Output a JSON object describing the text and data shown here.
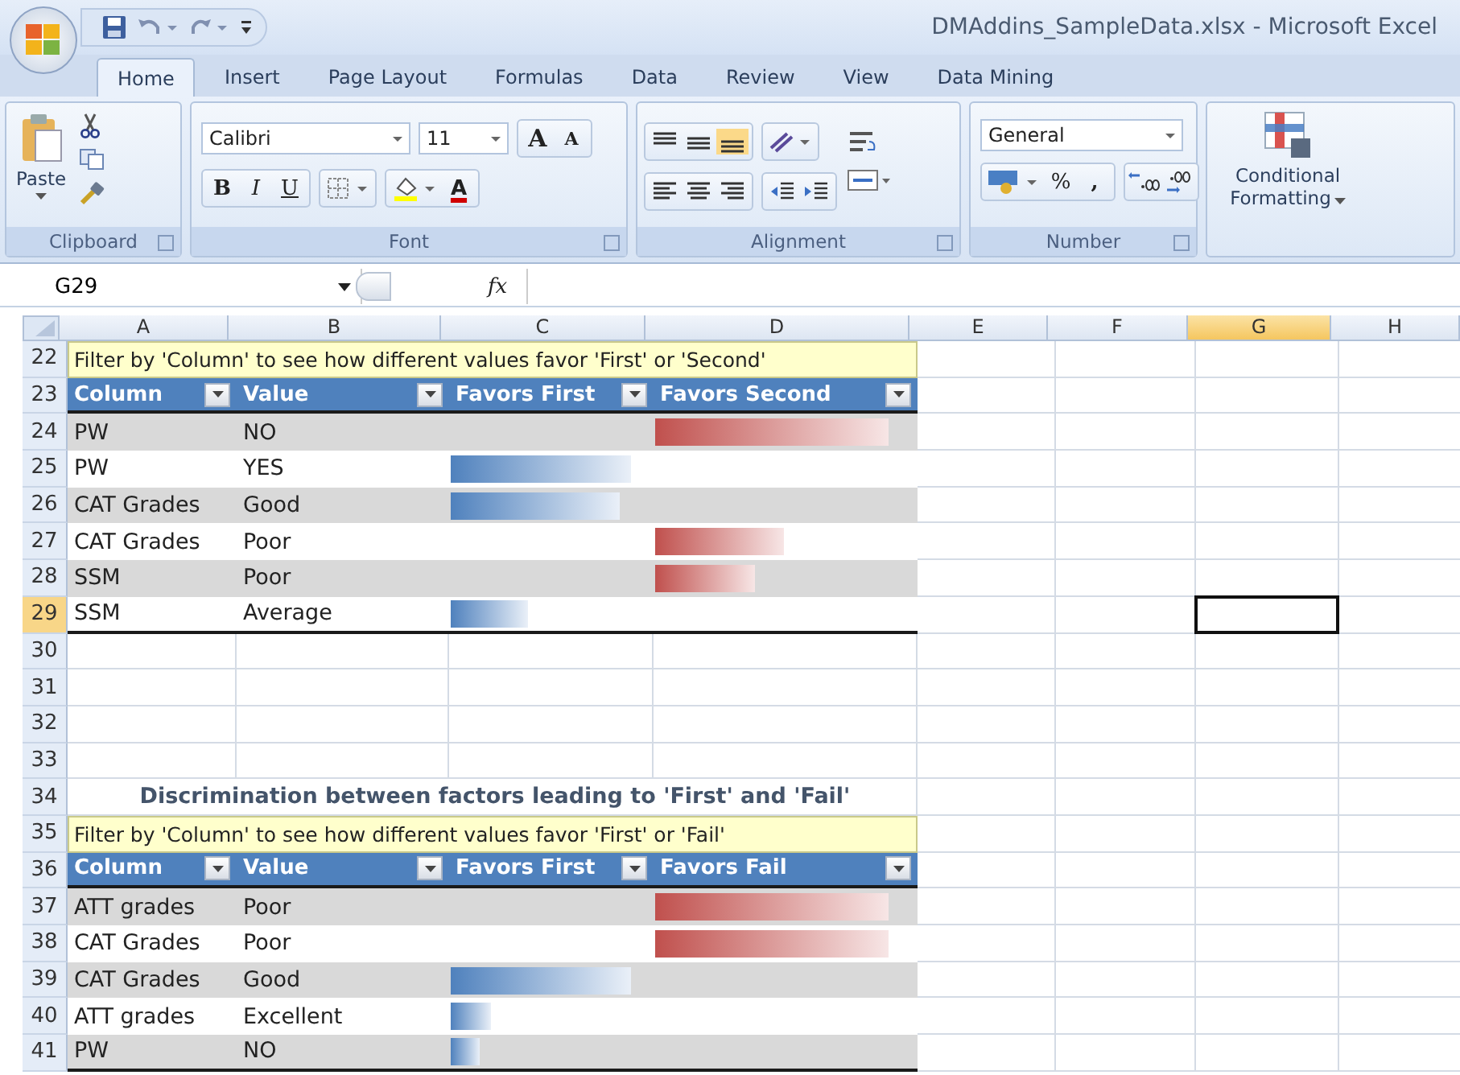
{
  "window": {
    "title": "DMAddins_SampleData.xlsx - Microsoft Excel"
  },
  "tabs": [
    {
      "label": "Home",
      "selected": true
    },
    {
      "label": "Insert",
      "selected": false
    },
    {
      "label": "Page Layout",
      "selected": false
    },
    {
      "label": "Formulas",
      "selected": false
    },
    {
      "label": "Data",
      "selected": false
    },
    {
      "label": "Review",
      "selected": false
    },
    {
      "label": "View",
      "selected": false
    },
    {
      "label": "Data Mining",
      "selected": false
    }
  ],
  "ribbon": {
    "clipboard": {
      "label": "Clipboard",
      "paste": "Paste"
    },
    "font": {
      "label": "Font",
      "name": "Calibri",
      "size": "11",
      "grow": "A",
      "shrink": "A",
      "bold": "B",
      "italic": "I",
      "underline": "U",
      "font_color": "A"
    },
    "alignment": {
      "label": "Alignment"
    },
    "number": {
      "label": "Number",
      "format": "General",
      "percent": "%",
      "comma": ","
    },
    "styles": {
      "conditional_formatting": "Conditional Formatting"
    }
  },
  "formula_bar": {
    "name_box": "G29",
    "function_label": "fx"
  },
  "sheet": {
    "columns": [
      {
        "label": "A",
        "selected": false
      },
      {
        "label": "B",
        "selected": false
      },
      {
        "label": "C",
        "selected": false
      },
      {
        "label": "D",
        "selected": false
      },
      {
        "label": "E",
        "selected": false
      },
      {
        "label": "F",
        "selected": false
      },
      {
        "label": "G",
        "selected": true
      },
      {
        "label": "H",
        "selected": false
      }
    ],
    "rows": [
      {
        "number": "22",
        "kind": "note",
        "selected": false,
        "text": "Filter by 'Column' to see how different values favor 'First' or 'Second'"
      },
      {
        "number": "23",
        "kind": "header",
        "selected": false,
        "labels": [
          "Column",
          "Value",
          "Favors First",
          "Favors Second"
        ]
      },
      {
        "number": "24",
        "kind": "data",
        "selected": false,
        "column": "PW",
        "value": "NO",
        "favors_second": {
          "level": 0.89
        }
      },
      {
        "number": "25",
        "kind": "data",
        "selected": false,
        "column": "PW",
        "value": "YES",
        "favors_first": {
          "level": 0.89
        }
      },
      {
        "number": "26",
        "kind": "data",
        "selected": false,
        "column": "CAT Grades",
        "value": "Good",
        "favors_first": {
          "level": 0.83
        }
      },
      {
        "number": "27",
        "kind": "data",
        "selected": false,
        "column": "CAT Grades",
        "value": "Poor",
        "favors_second": {
          "level": 0.49
        }
      },
      {
        "number": "28",
        "kind": "data",
        "selected": false,
        "column": "SSM",
        "value": "Poor",
        "favors_second": {
          "level": 0.38
        }
      },
      {
        "number": "29",
        "kind": "data",
        "selected": true,
        "column": "SSM",
        "value": "Average",
        "favors_first": {
          "level": 0.38
        }
      },
      {
        "number": "30",
        "kind": "empty",
        "selected": false
      },
      {
        "number": "31",
        "kind": "empty",
        "selected": false
      },
      {
        "number": "32",
        "kind": "empty",
        "selected": false
      },
      {
        "number": "33",
        "kind": "empty",
        "selected": false
      },
      {
        "number": "34",
        "kind": "title",
        "selected": false,
        "text": "Discrimination between factors leading to 'First' and 'Fail'"
      },
      {
        "number": "35",
        "kind": "note",
        "selected": false,
        "text": "Filter by 'Column' to see how different values favor 'First' or 'Fail'"
      },
      {
        "number": "36",
        "kind": "header",
        "selected": false,
        "labels": [
          "Column",
          "Value",
          "Favors First",
          "Favors Fail"
        ]
      },
      {
        "number": "37",
        "kind": "data",
        "selected": false,
        "column": "ATT grades",
        "value": "Poor",
        "favors_second": {
          "level": 0.89
        }
      },
      {
        "number": "38",
        "kind": "data",
        "selected": false,
        "column": "CAT Grades",
        "value": "Poor",
        "favors_second": {
          "level": 0.89
        }
      },
      {
        "number": "39",
        "kind": "data",
        "selected": false,
        "column": "CAT Grades",
        "value": "Good",
        "favors_first": {
          "level": 0.89
        }
      },
      {
        "number": "40",
        "kind": "data",
        "selected": false,
        "column": "ATT grades",
        "value": "Excellent",
        "favors_first": {
          "level": 0.2
        }
      },
      {
        "number": "41",
        "kind": "data",
        "selected": false,
        "column": "PW",
        "value": "NO",
        "favors_first": {
          "level": 0.14
        }
      }
    ]
  }
}
